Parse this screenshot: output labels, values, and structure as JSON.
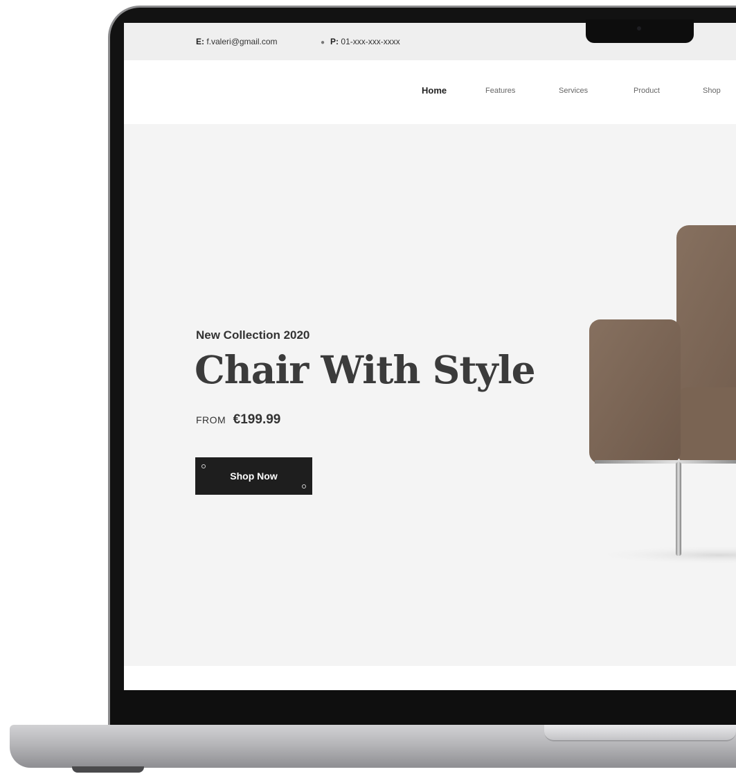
{
  "topbar": {
    "email_label": "E:",
    "email_value": "f.valeri@gmail.com",
    "phone_label": "P:",
    "phone_value": "01-xxx-xxx-xxxx"
  },
  "nav": {
    "items": [
      {
        "label": "Home",
        "active": true
      },
      {
        "label": "Features",
        "active": false
      },
      {
        "label": "Services",
        "active": false
      },
      {
        "label": "Product",
        "active": false
      },
      {
        "label": "Shop",
        "active": false
      }
    ]
  },
  "hero": {
    "eyebrow": "New Collection 2020",
    "title": "Chair With Style",
    "price_prefix": "FROM",
    "price": "€199.99",
    "cta_label": "Shop Now",
    "product_image": "armchair-brown-fabric"
  },
  "colors": {
    "accent_dark": "#1e1e1e",
    "chair_fabric": "#7d6656",
    "hero_background": "#f4f4f4"
  }
}
